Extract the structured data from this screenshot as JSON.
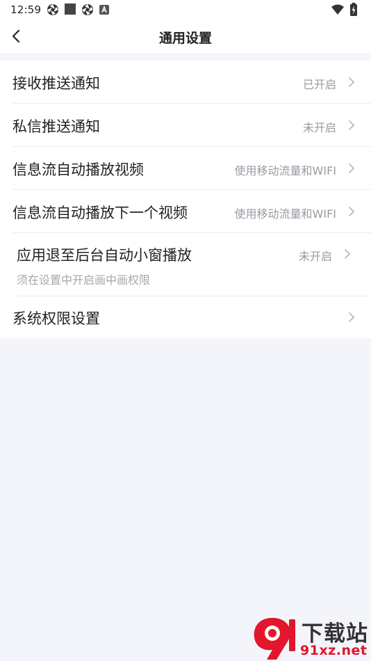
{
  "status_bar": {
    "time": "12:59",
    "icons": [
      "aperture-icon",
      "square-icon",
      "aperture-icon",
      "app-badge-icon"
    ],
    "right_icons": [
      "wifi-icon",
      "battery-charging-icon"
    ]
  },
  "header": {
    "title": "通用设置",
    "back_icon": "chevron-left-icon"
  },
  "settings": [
    {
      "label": "接收推送通知",
      "value": "已开启"
    },
    {
      "label": "私信推送通知",
      "value": "未开启"
    },
    {
      "label": "信息流自动播放视频",
      "value": "使用移动流量和WIFI"
    },
    {
      "label": "信息流自动播放下一个视频",
      "value": "使用移动流量和WIFI"
    },
    {
      "label": "应用退至后台自动小窗播放",
      "value": "未开启",
      "sub": "须在设置中开启画中画权限"
    },
    {
      "label": "系统权限设置",
      "value": ""
    }
  ],
  "watermark": {
    "title": "下载站",
    "url": "91xz.net",
    "badge_text": "9"
  },
  "colors": {
    "background": "#f4f5fa",
    "text": "#222222",
    "secondary": "#999aa3",
    "watermark_red": "#e2162c"
  }
}
